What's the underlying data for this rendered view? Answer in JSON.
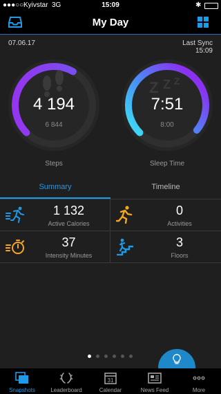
{
  "status_bar": {
    "carrier": "Kyivstar",
    "network": "3G",
    "time": "15:09"
  },
  "header": {
    "title": "My Day"
  },
  "info": {
    "date": "07.06.17",
    "sync_label": "Last Sync",
    "sync_time": "15:09"
  },
  "rings": [
    {
      "value": "4 194",
      "goal": "6 844",
      "label": "Steps",
      "icon": "footprints-icon",
      "progress": 0.61
    },
    {
      "value": "7:51",
      "goal": "8:00",
      "label": "Sleep Time",
      "icon": "sleep-zzz-icon",
      "progress": 0.98
    }
  ],
  "tabs": [
    {
      "label": "Summary",
      "active": true
    },
    {
      "label": "Timeline",
      "active": false
    }
  ],
  "tiles": [
    {
      "value": "1 132",
      "label": "Active Calories",
      "icon": "running-calories-icon",
      "color": "#1e9be8"
    },
    {
      "value": "0",
      "label": "Activities",
      "icon": "runner-icon",
      "color": "#f5a623"
    },
    {
      "value": "37",
      "label": "Intensity Minutes",
      "icon": "stopwatch-icon",
      "color": "#f5a623"
    },
    {
      "value": "3",
      "label": "Floors",
      "icon": "stairs-icon",
      "color": "#1e9be8"
    }
  ],
  "pager": {
    "count": 6,
    "active": 0
  },
  "fab": {
    "icon": "lightbulb-icon"
  },
  "bottom_nav": [
    {
      "label": "Snapshots",
      "icon": "snapshots-icon",
      "active": true
    },
    {
      "label": "Leaderboard",
      "icon": "laurel-icon",
      "active": false
    },
    {
      "label": "Calendar",
      "icon": "calendar-icon",
      "active": false,
      "icon_text": "31"
    },
    {
      "label": "News Feed",
      "icon": "news-feed-icon",
      "active": false
    },
    {
      "label": "More",
      "icon": "more-dots-icon",
      "active": false
    }
  ],
  "colors": {
    "accent": "#1e9be8",
    "ring_start": "#7b2ff7",
    "ring_end_sleep": "#3fd3f5",
    "track": "#2f2f2f",
    "orange": "#f5a623"
  }
}
